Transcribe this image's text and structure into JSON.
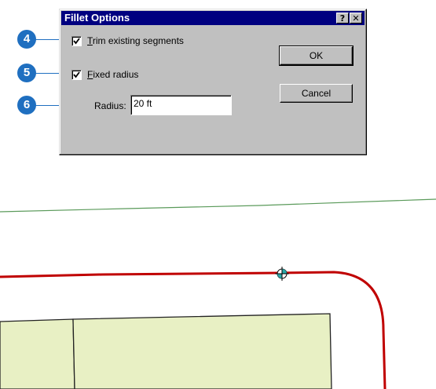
{
  "dialog": {
    "title": "Fillet Options",
    "help_button": "?",
    "close_button": "✕",
    "trim_checkbox": {
      "checked": true,
      "label_first": "T",
      "label_rest": "rim existing segments"
    },
    "fixed_checkbox": {
      "checked": true,
      "label_first": "F",
      "label_rest": "ixed radius"
    },
    "ok_label": "OK",
    "cancel_label": "Cancel",
    "radius_label": "Radius:",
    "radius_value": "20 ft"
  },
  "callouts": [
    "4",
    "5",
    "6"
  ],
  "colors": {
    "callout": "#1f6fc0",
    "titlebar": "#000080",
    "dialog_face": "#c0c0c0",
    "polygon_fill": "#e8f0c4",
    "line_red": "#c00000",
    "line_green": "#5a9a5a"
  },
  "map": {
    "cursor_icon": "snapping-crosshair-icon"
  }
}
